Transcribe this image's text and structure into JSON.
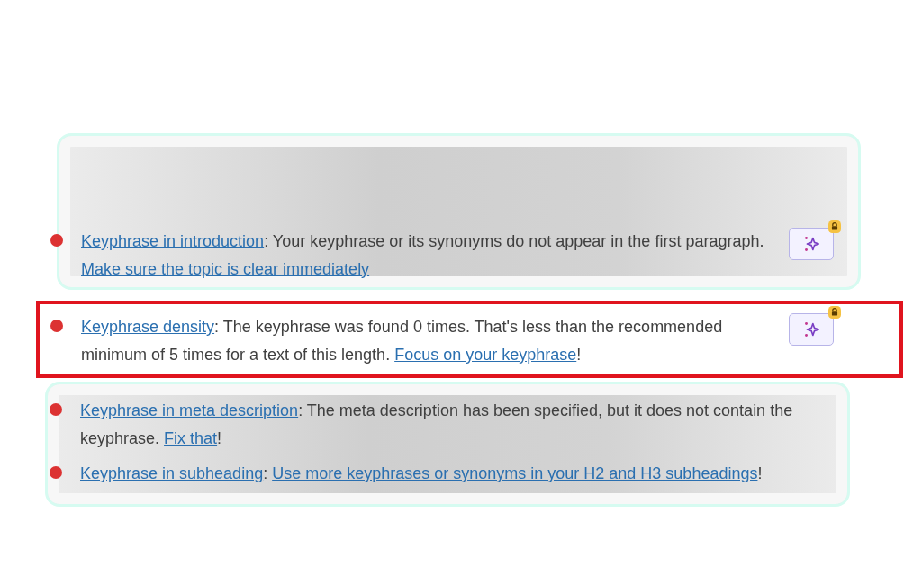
{
  "panels": [
    {
      "kind": "blurred",
      "items": [
        {
          "color": "#dc3232",
          "ai_button": true,
          "parts": [
            {
              "text": "Keyphrase in introduction",
              "link": true
            },
            {
              "text": ": Your keyphrase or its synonyms do not appear in the first paragraph. ",
              "link": false
            },
            {
              "text": "Make sure the topic is clear immediately",
              "link": true
            }
          ]
        }
      ]
    },
    {
      "kind": "focused",
      "items": [
        {
          "color": "#dc3232",
          "ai_button": true,
          "parts": [
            {
              "text": "Keyphrase density",
              "link": true
            },
            {
              "text": ": The keyphrase was found 0 times. That's less than the recommended minimum of 5 times for a text of this length. ",
              "link": false
            },
            {
              "text": "Focus on your keyphrase",
              "link": true
            },
            {
              "text": "!",
              "link": false
            }
          ]
        }
      ]
    },
    {
      "kind": "blurred",
      "items": [
        {
          "color": "#dc3232",
          "ai_button": false,
          "parts": [
            {
              "text": "Keyphrase in meta description",
              "link": true
            },
            {
              "text": ": The meta description has been specified, but it does not contain the keyphrase. ",
              "link": false
            },
            {
              "text": "Fix that",
              "link": true
            },
            {
              "text": "!",
              "link": false
            }
          ]
        },
        {
          "color": "#dc3232",
          "ai_button": false,
          "parts": [
            {
              "text": "Keyphrase in subheading",
              "link": true
            },
            {
              "text": ": ",
              "link": false
            },
            {
              "text": "Use more keyphrases or synonyms in your H2 and H3 subheadings",
              "link": true
            },
            {
              "text": "!",
              "link": false
            }
          ]
        }
      ]
    }
  ]
}
